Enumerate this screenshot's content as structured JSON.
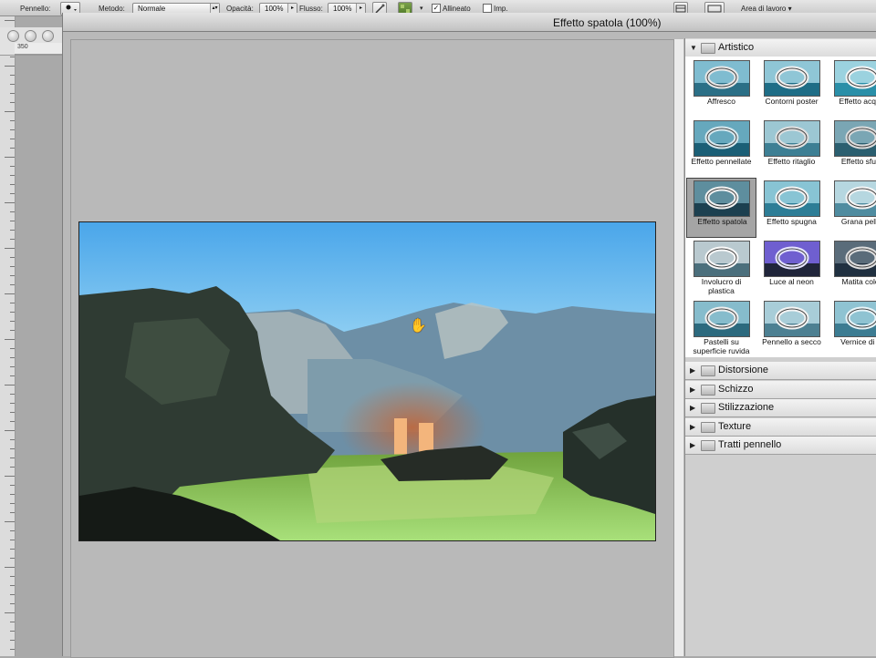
{
  "options_bar": {
    "brush_label": "Pennello:",
    "mode_label": "Metodo:",
    "mode_value": "Normale",
    "opacity_label": "Opacità:",
    "opacity_value": "100%",
    "flow_label": "Flusso:",
    "flow_value": "100%",
    "aligned_label": "Allineato",
    "sample_label": "Imp.",
    "workspace_label": "Area di lavoro"
  },
  "ruler": {
    "h_value": "350"
  },
  "dialog": {
    "title": "Effetto spatola (100%)",
    "cursor": "hand-icon"
  },
  "filter_panel": {
    "open_category": "Artistico",
    "filters": [
      {
        "label": "Affresco",
        "icon": "affresco-thumbnail",
        "selected": false
      },
      {
        "label": "Contorni poster",
        "icon": "contorni-poster-thumbnail",
        "selected": false
      },
      {
        "label": "Effetto acque",
        "icon": "effetto-acquerello-thumbnail",
        "selected": false
      },
      {
        "label": "Effetto pennellate",
        "icon": "effetto-pennellate-thumbnail",
        "selected": false
      },
      {
        "label": "Effetto ritaglio",
        "icon": "effetto-ritaglio-thumbnail",
        "selected": false
      },
      {
        "label": "Effetto sfum",
        "icon": "effetto-sfumino-thumbnail",
        "selected": false
      },
      {
        "label": "Effetto spatola",
        "icon": "effetto-spatola-thumbnail",
        "selected": true
      },
      {
        "label": "Effetto spugna",
        "icon": "effetto-spugna-thumbnail",
        "selected": false
      },
      {
        "label": "Grana pellic",
        "icon": "grana-pellicola-thumbnail",
        "selected": false
      },
      {
        "label": "Involucro di",
        "label2": "plastica",
        "icon": "involucro-plastica-thumbnail",
        "selected": false
      },
      {
        "label": "Luce al neon",
        "icon": "luce-neon-thumbnail",
        "selected": false
      },
      {
        "label": "Matita color",
        "icon": "matita-colorata-thumbnail",
        "selected": false
      },
      {
        "label": "Pastelli su",
        "label2": "superficie ruvida",
        "icon": "pastelli-thumbnail",
        "selected": false
      },
      {
        "label": "Pennello a secco",
        "icon": "pennello-secco-thumbnail",
        "selected": false
      },
      {
        "label": "Vernice di fo",
        "icon": "vernice-fondo-thumbnail",
        "selected": false
      }
    ],
    "categories": [
      "Distorsione",
      "Schizzo",
      "Stilizzazione",
      "Texture",
      "Tratti pennello"
    ]
  },
  "colors": {
    "sky_top": "#4aa6ea",
    "panel_bg": "#d6d6d6",
    "dialog_bg": "#b9b9b9"
  }
}
